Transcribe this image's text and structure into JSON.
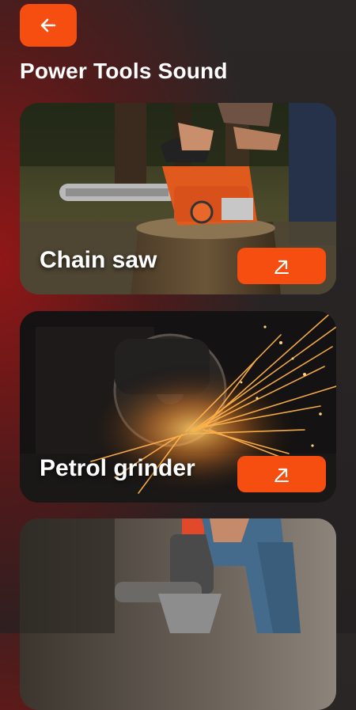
{
  "header": {
    "back_icon": "arrow-left-icon",
    "title": "Power Tools Sound"
  },
  "cards": [
    {
      "label": "Chain saw",
      "image": "chainsaw-photo",
      "action_icon": "arrow-up-right-icon"
    },
    {
      "label": "Petrol grinder",
      "image": "angle-grinder-sparks-photo",
      "action_icon": "arrow-up-right-icon"
    },
    {
      "label": "",
      "image": "jackhammer-photo",
      "action_icon": "arrow-up-right-icon"
    }
  ],
  "colors": {
    "accent": "#f64d10",
    "background": "#2b2727",
    "gradient_red": "#961616",
    "text": "#ffffff"
  }
}
